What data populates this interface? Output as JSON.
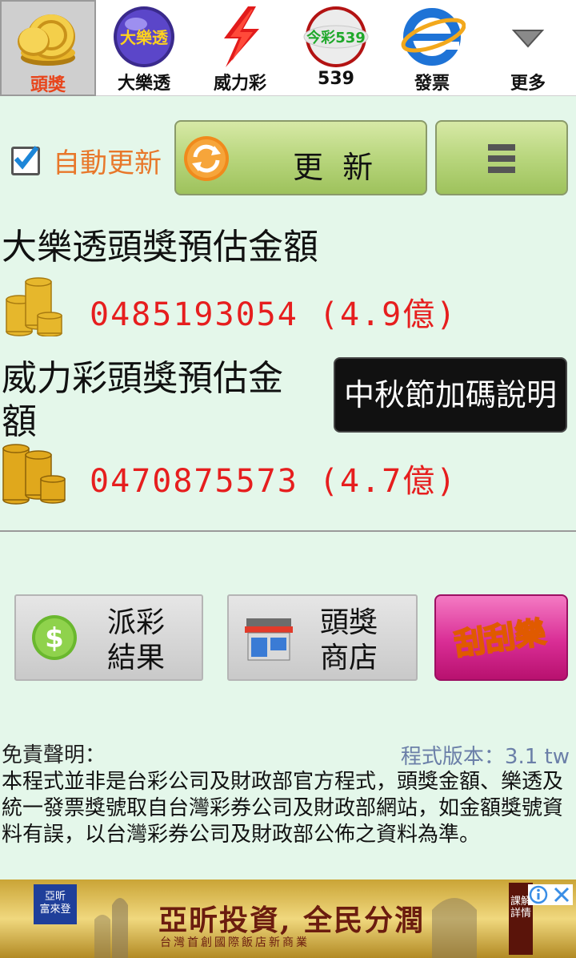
{
  "tabs": [
    {
      "label": "頭獎",
      "icon": "gold-coin-icon",
      "active": true
    },
    {
      "label": "大樂透",
      "icon": "lotto-ball-icon",
      "badge": "大樂透"
    },
    {
      "label": "威力彩",
      "icon": "lightning-icon"
    },
    {
      "label": "539",
      "icon": "ball-539-icon",
      "badge": "今彩539"
    },
    {
      "label": "發票",
      "icon": "browser-e-icon"
    },
    {
      "label": "更多",
      "icon": "chevron-down-icon"
    }
  ],
  "refresh": {
    "auto_label": "自動更新",
    "auto_checked": true,
    "button_label": "更 新"
  },
  "jackpots": {
    "lotto": {
      "title": "大樂透頭獎預估金額",
      "amount": "0485193054 (4.9億)"
    },
    "power": {
      "title_line1": "威力彩頭獎預估金",
      "title_line2": "額",
      "amount": "0470875573 (4.7億)"
    },
    "promo_button": "中秋節加碼說明"
  },
  "bottom": {
    "payout_label_1": "派彩",
    "payout_label_2": "結果",
    "store_label_1": "頭獎",
    "store_label_2": "商店",
    "scratch_label": "刮刮樂"
  },
  "disclaimer": {
    "title": "免責聲明：",
    "version": "程式版本：3.1 tw",
    "body": "本程式並非是台彩公司及財政部官方程式，頭獎金額、樂透及統一發票獎號取自台灣彩券公司及財政部網站，如金額獎號資料有誤，以台灣彩券公司及財政部公佈之資料為準。"
  },
  "ad": {
    "headline": "亞昕投資, 全民分潤",
    "subline": "台灣首創國際飯店新商業",
    "logo_line1": "亞昕",
    "logo_line2": "富來登",
    "side_tag": "課解詳情",
    "colors": {
      "text": "#6b1c0f",
      "gold": "#e0bf56"
    }
  },
  "colors": {
    "background": "#e4f7ea",
    "accent_orange": "#e8451c",
    "amount_red": "#e61e1e",
    "button_green": "#b8d67d",
    "scratch_pink": "#d92d95"
  }
}
